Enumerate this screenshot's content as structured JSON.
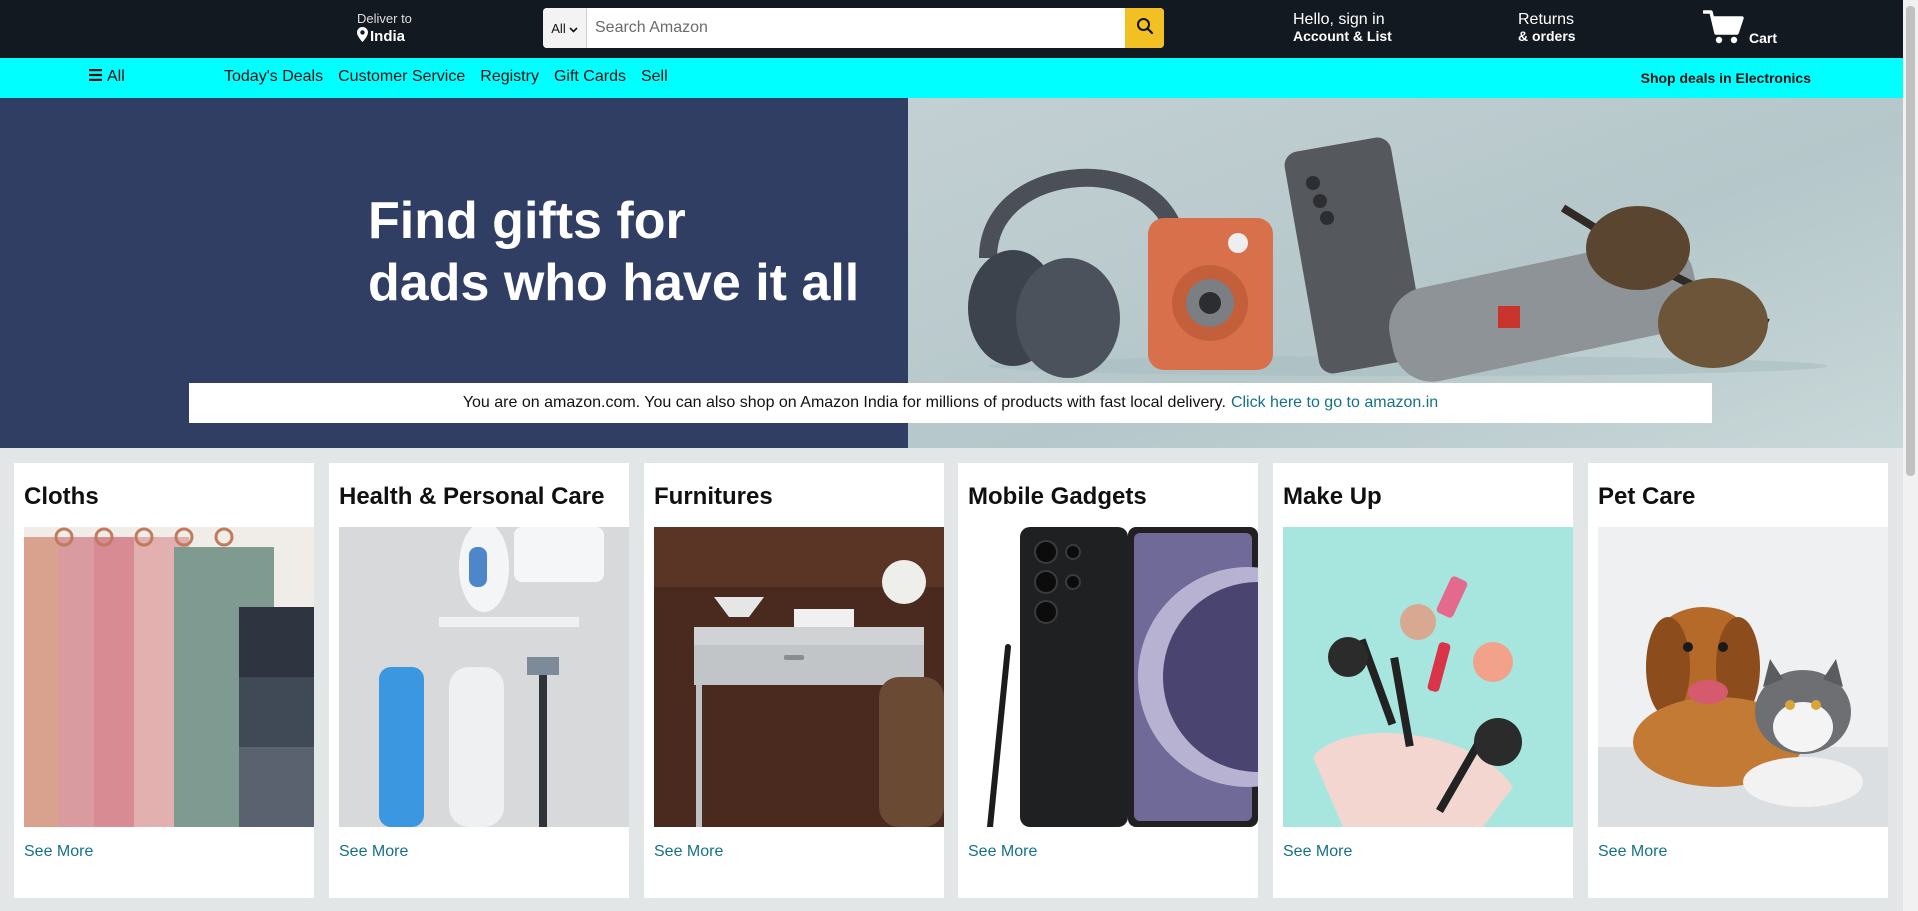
{
  "header": {
    "deliver_to_label": "Deliver to",
    "deliver_to_location": "India",
    "search_category": "All",
    "search_placeholder": "Search Amazon",
    "account_greeting": "Hello, sign in",
    "account_menu": "Account & List",
    "returns_line1": "Returns",
    "returns_line2": "& orders",
    "cart_label": "Cart"
  },
  "nav": {
    "all_label": "All",
    "links": [
      "Today's Deals",
      "Customer Service",
      "Registry",
      "Gift Cards",
      "Sell"
    ],
    "promo": "Shop deals in Electronics"
  },
  "hero": {
    "headline_line1": "Find gifts for",
    "headline_line2": "dads who have it all"
  },
  "notice": {
    "text": "You are on amazon.com. You can also shop on Amazon India for millions of products with fast local delivery.",
    "link": "Click here to go to amazon.in"
  },
  "categories": [
    {
      "title": "Cloths",
      "link": "See More"
    },
    {
      "title": "Health & Personal Care",
      "link": "See More"
    },
    {
      "title": "Furnitures",
      "link": "See More"
    },
    {
      "title": "Mobile Gadgets",
      "link": "See More"
    },
    {
      "title": "Make Up",
      "link": "See More"
    },
    {
      "title": "Pet Care",
      "link": "See More"
    }
  ],
  "colors": {
    "topbar": "#131921",
    "navbar": "#00ffff",
    "hero_left": "#303e64",
    "search_button": "#f3c024",
    "link": "#157189"
  },
  "icons": {
    "location": "location-pin-icon",
    "search": "search-icon",
    "cart": "cart-icon",
    "menu": "hamburger-menu-icon"
  }
}
